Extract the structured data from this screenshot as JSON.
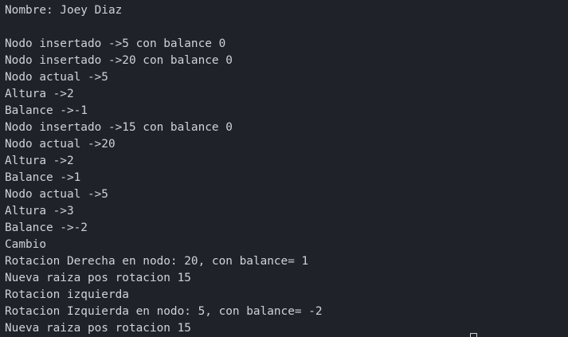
{
  "terminal": {
    "lines": [
      "Nombre: Joey Diaz",
      "",
      "Nodo insertado ->5 con balance 0",
      "Nodo insertado ->20 con balance 0",
      "Nodo actual ->5",
      "Altura ->2",
      "Balance ->-1",
      "Nodo insertado ->15 con balance 0",
      "Nodo actual ->20",
      "Altura ->2",
      "Balance ->1",
      "Nodo actual ->5",
      "Altura ->3",
      "Balance ->-2",
      "Cambio",
      "Rotacion Derecha en nodo: 20, con balance= 1",
      "Nueva raiza pos rotacion 15",
      "Rotacion izquierda",
      "Rotacion Izquierda en nodo: 5, con balance= -2",
      "Nueva raiza pos rotacion 15"
    ]
  },
  "colors": {
    "background": "#1f2329",
    "text": "#cfd3d8"
  }
}
